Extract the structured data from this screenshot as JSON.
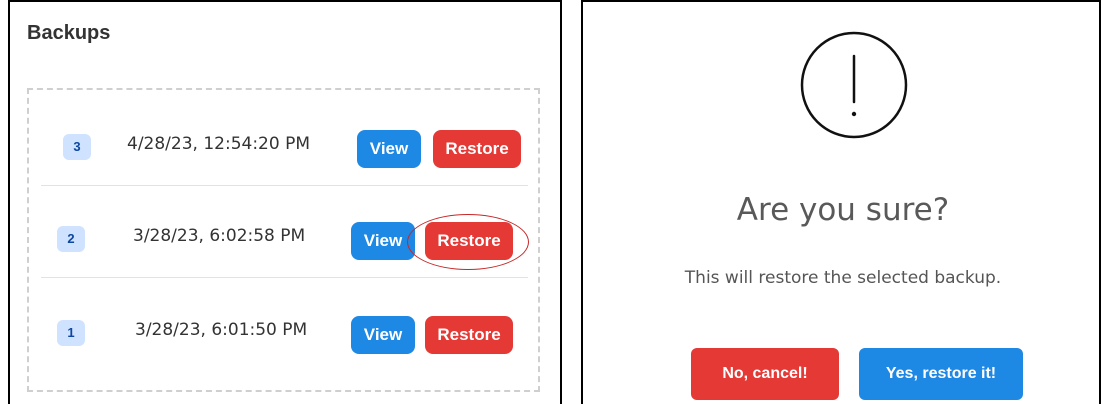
{
  "backups": {
    "title": "Backups",
    "rows": [
      {
        "number": "3",
        "timestamp": "4/28/23, 12:54:20 PM",
        "view_label": "View",
        "restore_label": "Restore"
      },
      {
        "number": "2",
        "timestamp": "3/28/23, 6:02:58 PM",
        "view_label": "View",
        "restore_label": "Restore",
        "highlighted": true
      },
      {
        "number": "1",
        "timestamp": "3/28/23, 6:01:50 PM",
        "view_label": "View",
        "restore_label": "Restore"
      }
    ]
  },
  "dialog": {
    "icon": "exclamation-icon",
    "title": "Are you sure?",
    "text": "This will restore the selected backup.",
    "cancel_label": "No, cancel!",
    "confirm_label": "Yes, restore it!"
  },
  "colors": {
    "primary": "#1e88e5",
    "danger": "#e53935",
    "badge_bg": "#cfe2ff",
    "highlight": "#c62828"
  }
}
